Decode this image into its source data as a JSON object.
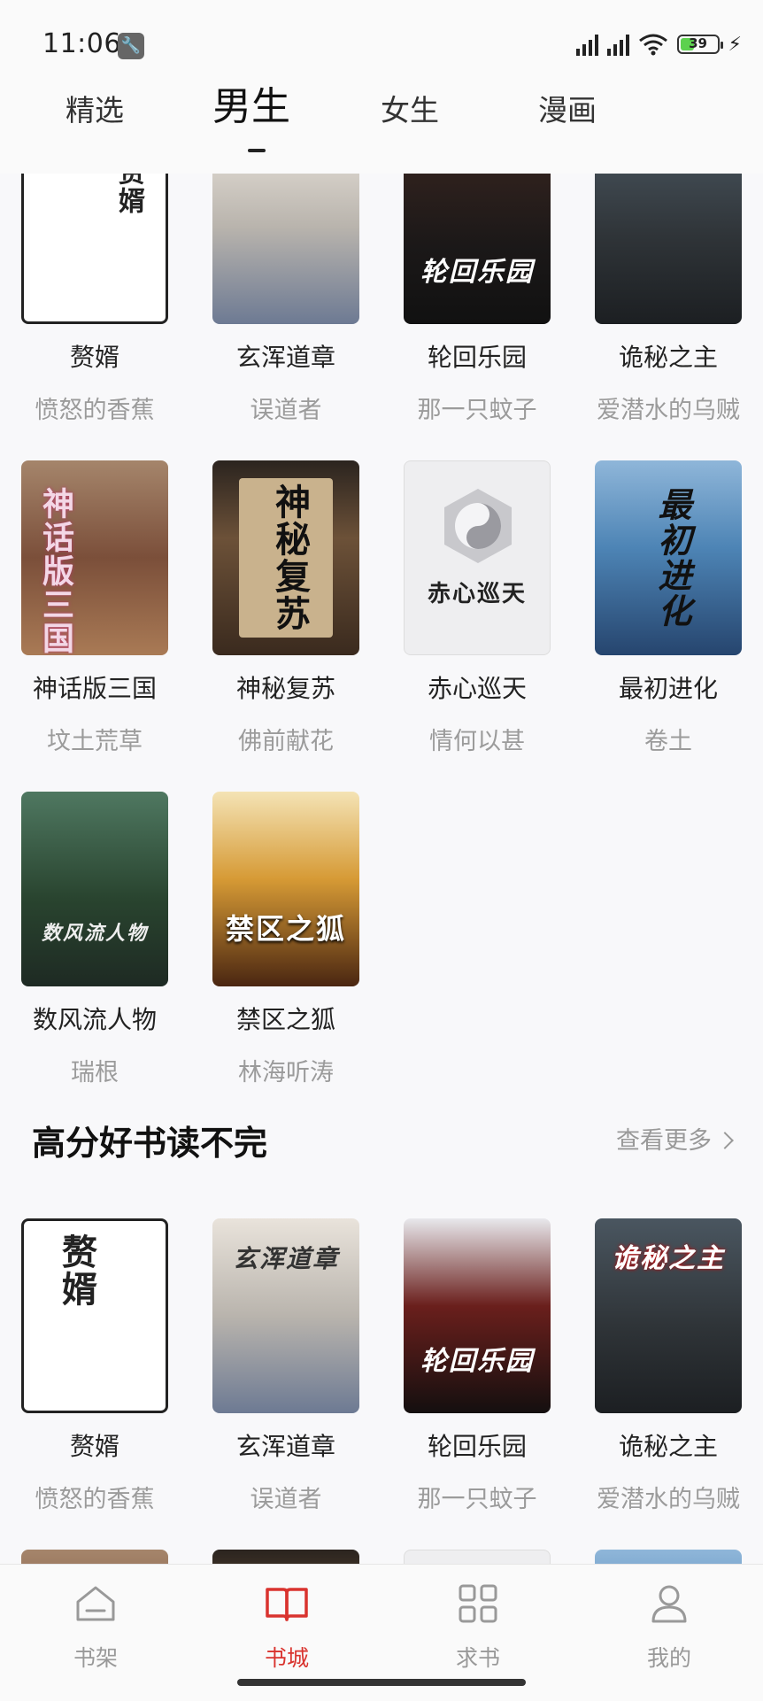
{
  "status_bar": {
    "time": "11:06",
    "battery": "39",
    "battery_level": 0.39
  },
  "tabs": [
    {
      "label": "精选"
    },
    {
      "label": "男生"
    },
    {
      "label": "女生"
    },
    {
      "label": "漫画"
    }
  ],
  "active_tab": "男生",
  "grid1": [
    {
      "title": "赘婿",
      "author": "愤怒的香蕉",
      "cover_text": "赘婿"
    },
    {
      "title": "玄浑道章",
      "author": "误道者",
      "cover_text": ""
    },
    {
      "title": "轮回乐园",
      "author": "那一只蚊子",
      "cover_text": "轮回乐园"
    },
    {
      "title": "诡秘之主",
      "author": "爱潜水的乌贼",
      "cover_text": ""
    },
    {
      "title": "神话版三国",
      "author": "坟土荒草",
      "cover_text": "神话版三国"
    },
    {
      "title": "神秘复苏",
      "author": "佛前献花",
      "cover_text": "神秘复苏"
    },
    {
      "title": "赤心巡天",
      "author": "情何以甚",
      "cover_text": "赤心巡天"
    },
    {
      "title": "最初进化",
      "author": "卷土",
      "cover_text": "最初进化"
    },
    {
      "title": "数风流人物",
      "author": "瑞根",
      "cover_text": "数风流人物"
    },
    {
      "title": "禁区之狐",
      "author": "林海听涛",
      "cover_text": "禁区之狐"
    }
  ],
  "section": {
    "title": "高分好书读不完",
    "more": "查看更多"
  },
  "grid2": [
    {
      "title": "赘婿",
      "author": "愤怒的香蕉",
      "cover_text": "赘婿"
    },
    {
      "title": "玄浑道章",
      "author": "误道者",
      "cover_text": "玄浑道章"
    },
    {
      "title": "轮回乐园",
      "author": "那一只蚊子",
      "cover_text": "轮回乐园"
    },
    {
      "title": "诡秘之主",
      "author": "爱潜水的乌贼",
      "cover_text": "诡秘之主"
    }
  ],
  "bottom_nav": [
    {
      "label": "书架",
      "icon": "shelf-icon"
    },
    {
      "label": "书城",
      "icon": "book-icon"
    },
    {
      "label": "求书",
      "icon": "grid-icon"
    },
    {
      "label": "我的",
      "icon": "user-icon"
    }
  ],
  "colors": {
    "accent": "#d9332e",
    "muted": "#9b9b9b"
  }
}
